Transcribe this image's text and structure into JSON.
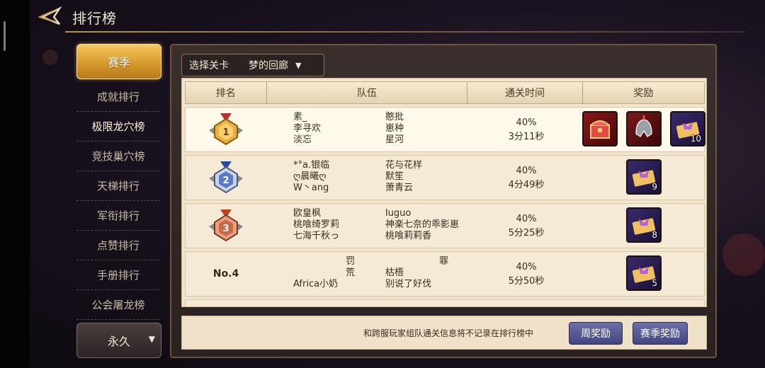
{
  "header": {
    "title": "排行榜"
  },
  "sidebar": {
    "active": "赛季",
    "items": [
      {
        "label": "成就排行"
      },
      {
        "label": "极限龙穴榜"
      },
      {
        "label": "竞技巢穴榜"
      },
      {
        "label": "天梯排行"
      },
      {
        "label": "军衔排行"
      },
      {
        "label": "点赞排行"
      },
      {
        "label": "手册排行"
      },
      {
        "label": "公会屠龙榜"
      }
    ],
    "period": "永久"
  },
  "stage": {
    "label": "选择关卡",
    "value": "梦的回廊"
  },
  "table": {
    "headers": {
      "rank": "排名",
      "team": "队伍",
      "time": "通关时间",
      "reward": "奖励"
    },
    "rows": [
      {
        "rank": "1",
        "team_a": [
          "素_",
          "李寻欢",
          "淡忘"
        ],
        "team_b": [
          "憨批",
          "崽种",
          "星河"
        ],
        "progress": "40%",
        "time": "3分11秒",
        "rewards": [
          {
            "icon": "treasure-chest-icon",
            "count": ""
          },
          {
            "icon": "helmet-icon",
            "count": ""
          },
          {
            "icon": "ticket-icon",
            "count": "10"
          }
        ]
      },
      {
        "rank": "2",
        "team_a": [
          "*°a.银临",
          "ღ晨曦ღ",
          "W丶ang"
        ],
        "team_b": [
          "花与花样",
          "默笙",
          "萧青云"
        ],
        "progress": "40%",
        "time": "4分49秒",
        "rewards": [
          {
            "icon": "ticket-icon",
            "count": "9"
          }
        ]
      },
      {
        "rank": "3",
        "team_a": [
          "欧皇枫",
          "桃喰绮罗莉",
          "七海千秋っ"
        ],
        "team_b": [
          "luguo",
          "神楽七奈的乖影崽",
          "桃喰莉莉香"
        ],
        "progress": "40%",
        "time": "5分25秒",
        "rewards": [
          {
            "icon": "ticket-icon",
            "count": "8"
          }
        ]
      },
      {
        "rank": "No.4",
        "team_a": [
          "罚",
          "荒",
          "Africa小奶"
        ],
        "team_b": [
          "罪",
          "枯梧",
          "别说了好伐"
        ],
        "progress": "40%",
        "time": "5分50秒",
        "rewards": [
          {
            "icon": "ticket-icon",
            "count": "5"
          }
        ]
      }
    ]
  },
  "footer": {
    "note": "和跨服玩家组队通关信息将不记录在排行榜中",
    "weekly_button": "周奖励",
    "season_button": "赛季奖励"
  },
  "colors": {
    "accent_gold": "#d69a2e",
    "button_purple": "#5a5c96",
    "panel_cream": "#f1e5cf"
  }
}
